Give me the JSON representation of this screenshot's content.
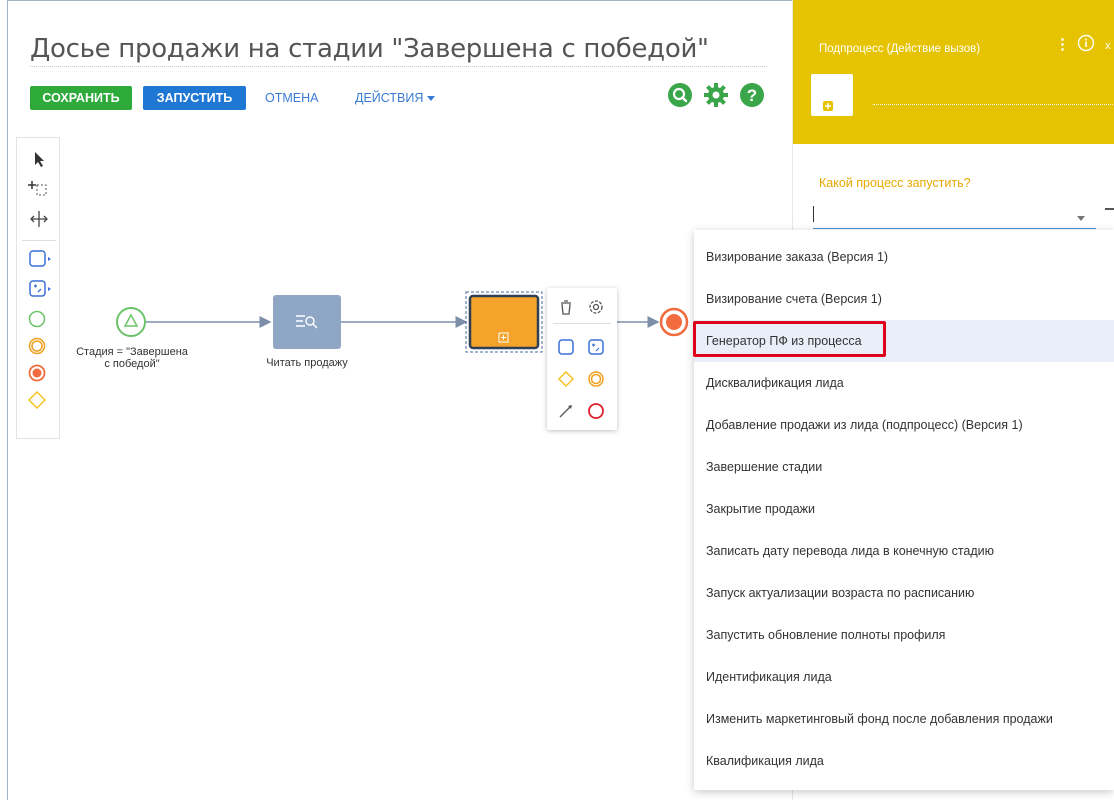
{
  "page": {
    "title": "Досье продажи на стадии \"Завершена с победой\""
  },
  "toolbar": {
    "save_label": "СОХРАНИТЬ",
    "run_label": "ЗАПУСТИТЬ",
    "cancel_label": "ОТМЕНА",
    "actions_label": "ДЕЙСТВИЯ"
  },
  "diagram": {
    "start_label_line1": "Стадия = \"Завершена",
    "start_label_line2": "с победой\"",
    "read_task_label": "Читать продажу"
  },
  "right_panel": {
    "header_title": "Подпроцесс (Действие вызов)",
    "header_close": "х",
    "question_label": "Какой процесс запустить?",
    "input_value": ""
  },
  "dropdown": {
    "selected_index": 2,
    "items": [
      "Визирование заказа (Версия 1)",
      "Визирование счета (Версия 1)",
      "Генератор ПФ из процесса",
      "Дисквалификация лида",
      "Добавление продажи из лида (подпроцесс) (Версия 1)",
      "Завершение стадии",
      "Закрытие продажи",
      "Записать дату перевода лида в конечную стадию",
      "Запуск актуализации возраста по расписанию",
      "Запустить обновление полноты профиля",
      "Идентификация лида",
      "Изменить маркетинговый фонд после добавления продажи",
      "Квалификация лида"
    ]
  },
  "icons": {
    "search": "search-icon",
    "settings": "gear-icon",
    "help": "help-icon",
    "pointer": "pointer-icon",
    "marquee": "marquee-select-icon",
    "move": "move-icon",
    "task": "task-icon",
    "subprocess": "subprocess-icon",
    "start": "start-event-icon",
    "intermediate": "intermediate-event-icon",
    "end": "end-event-icon",
    "gateway": "gateway-icon",
    "delete": "trash-icon",
    "properties": "gear-outline-icon",
    "connector": "connector-icon"
  },
  "colors": {
    "save": "#2eaa3a",
    "run": "#1f77d4",
    "panel_header": "#e6c300",
    "task": "#8fa6c5",
    "subprocess": "#f5a32a",
    "end_event": "#f26c3f",
    "highlight": "#e0001b"
  }
}
